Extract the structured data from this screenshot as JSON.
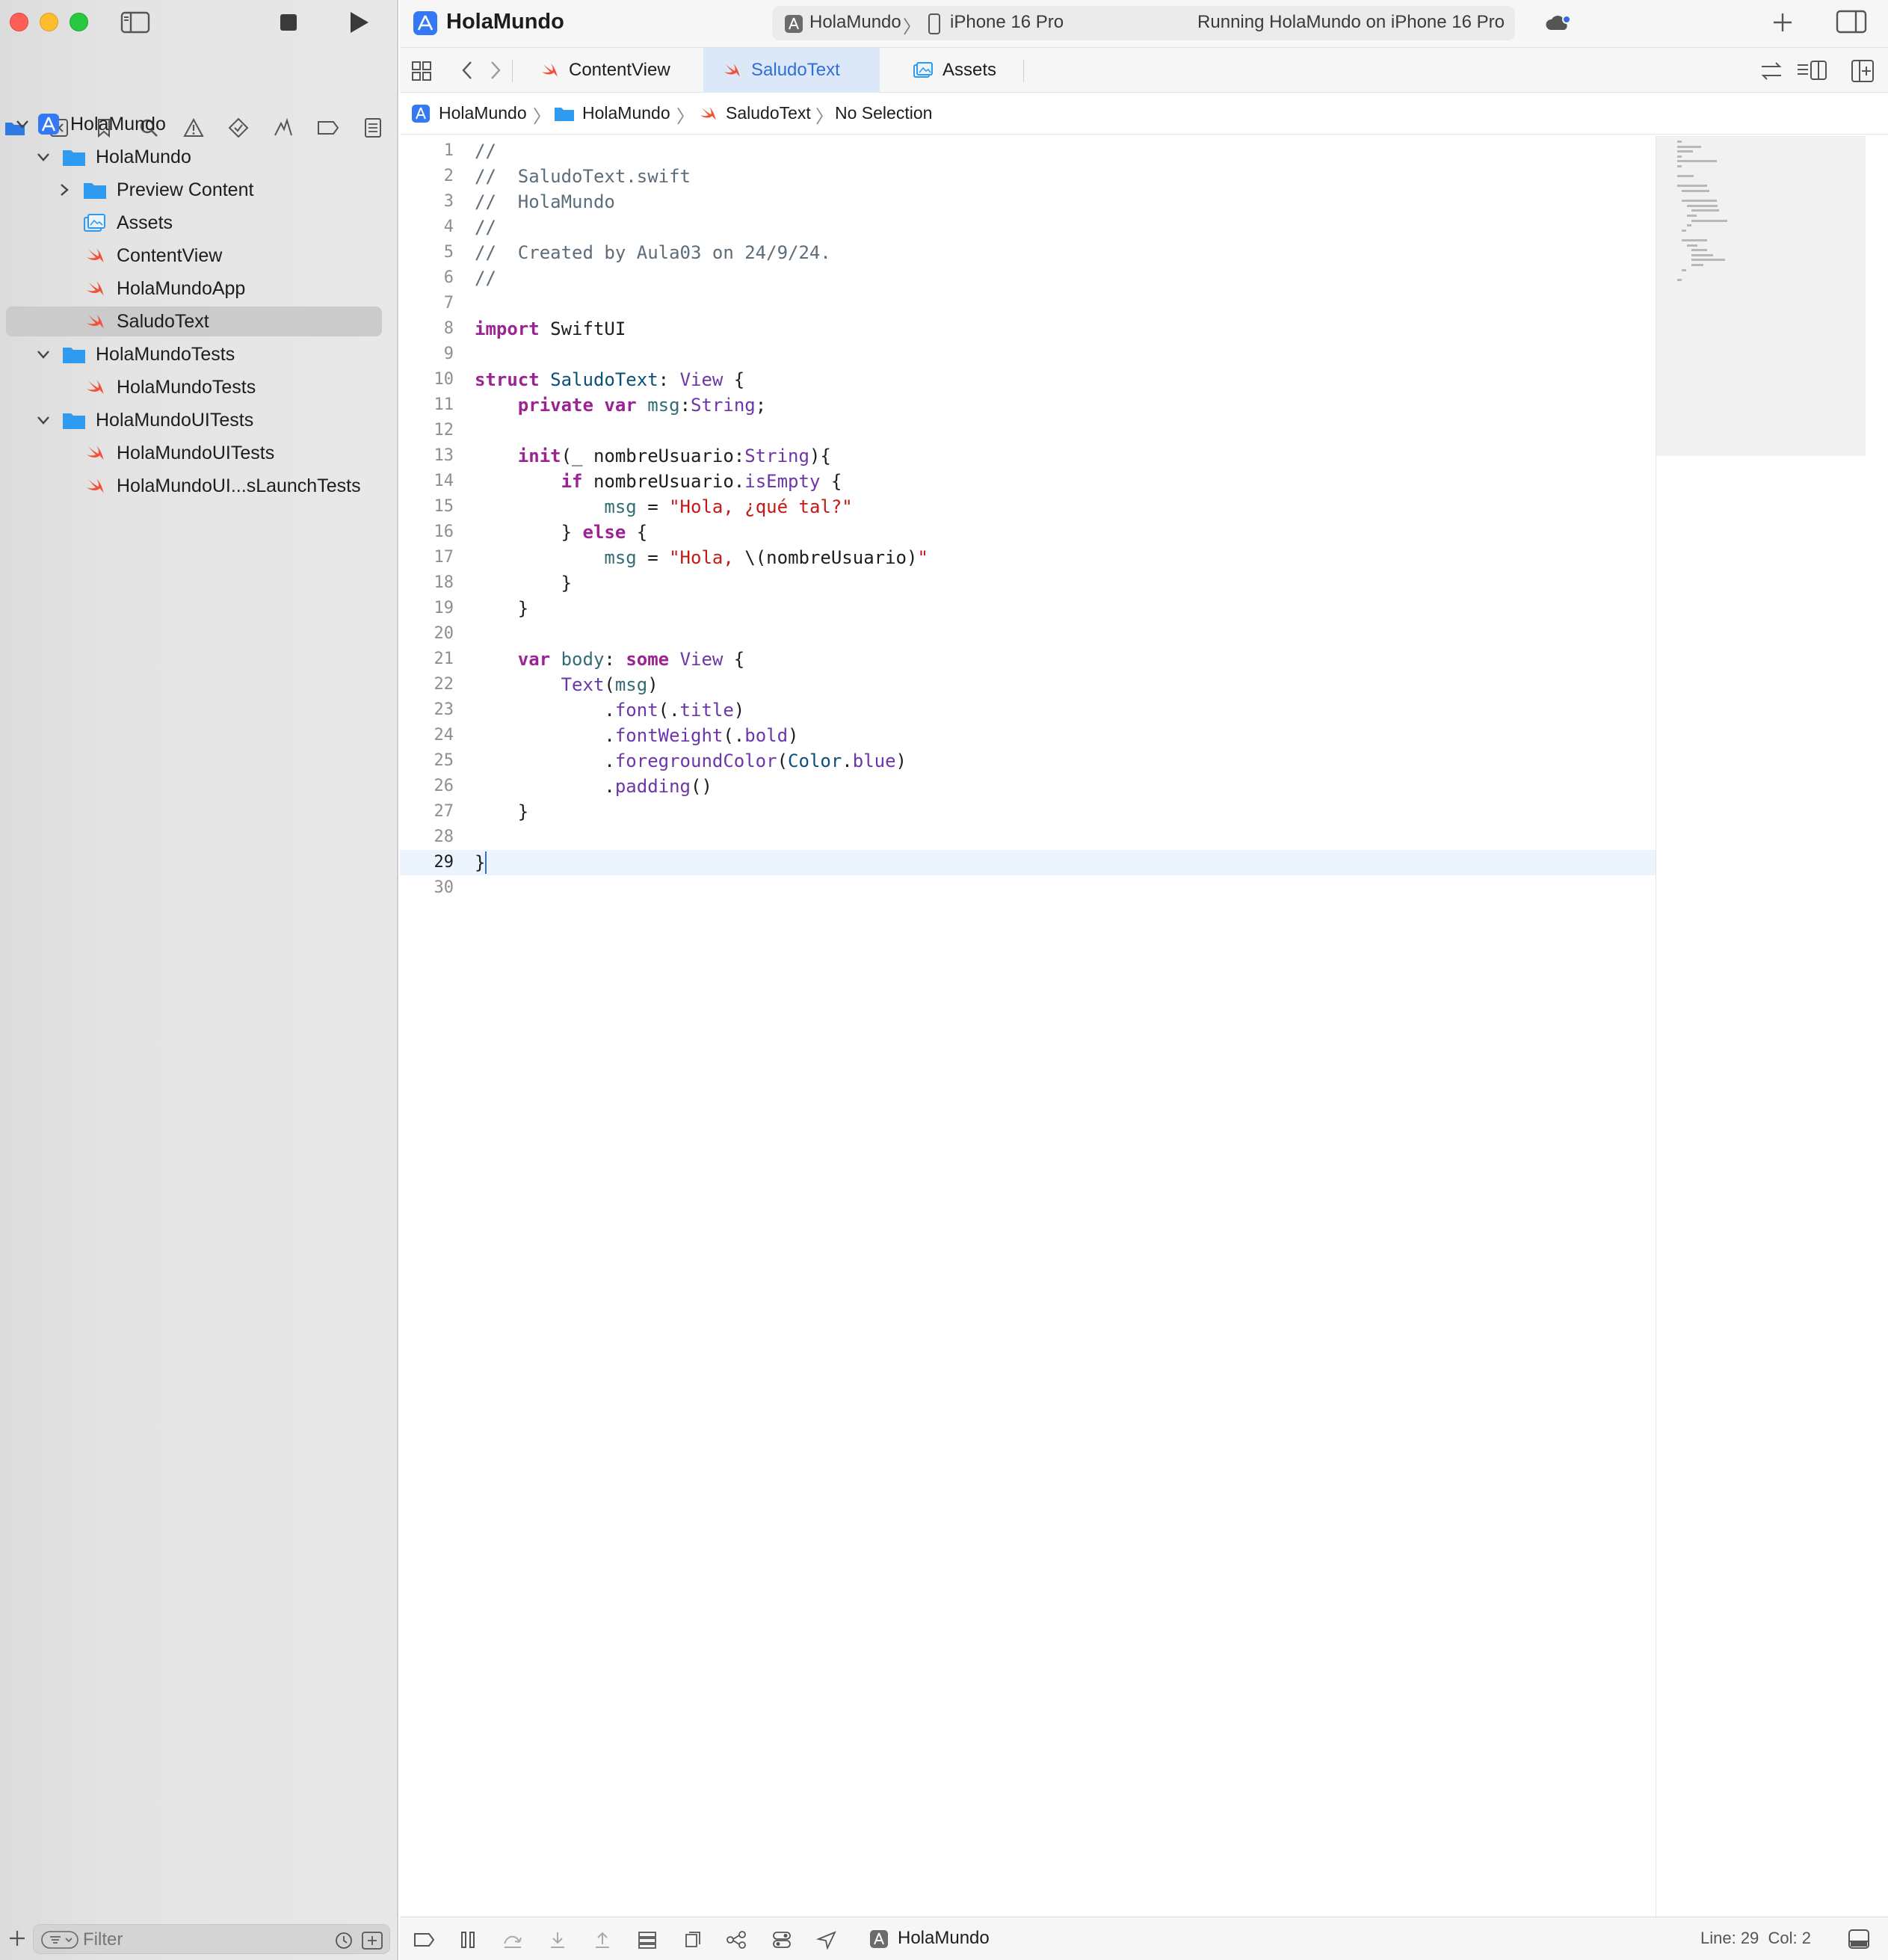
{
  "window": {
    "project_title": "HolaMundo"
  },
  "scheme": {
    "target": "HolaMundo",
    "device": "iPhone 16 Pro",
    "status": "Running HolaMundo on iPhone 16 Pro"
  },
  "navigator": {
    "tree": [
      {
        "label": "HolaMundo",
        "kind": "project",
        "level": 0,
        "disclosure": "open"
      },
      {
        "label": "HolaMundo",
        "kind": "folder",
        "level": 1,
        "disclosure": "open"
      },
      {
        "label": "Preview Content",
        "kind": "folder",
        "level": 2,
        "disclosure": "closed"
      },
      {
        "label": "Assets",
        "kind": "assets",
        "level": 2,
        "disclosure": "none"
      },
      {
        "label": "ContentView",
        "kind": "swift",
        "level": 2,
        "disclosure": "none"
      },
      {
        "label": "HolaMundoApp",
        "kind": "swift",
        "level": 2,
        "disclosure": "none"
      },
      {
        "label": "SaludoText",
        "kind": "swift",
        "level": 2,
        "disclosure": "none",
        "selected": true
      },
      {
        "label": "HolaMundoTests",
        "kind": "folder",
        "level": 1,
        "disclosure": "open"
      },
      {
        "label": "HolaMundoTests",
        "kind": "swift",
        "level": 2,
        "disclosure": "none"
      },
      {
        "label": "HolaMundoUITests",
        "kind": "folder",
        "level": 1,
        "disclosure": "open"
      },
      {
        "label": "HolaMundoUITests",
        "kind": "swift",
        "level": 2,
        "disclosure": "none"
      },
      {
        "label": "HolaMundoUI...sLaunchTests",
        "kind": "swift",
        "level": 2,
        "disclosure": "none"
      }
    ],
    "filter_placeholder": "Filter"
  },
  "tabs": [
    {
      "label": "ContentView",
      "icon": "swift-file-icon",
      "active": false
    },
    {
      "label": "SaludoText",
      "icon": "swift-file-icon",
      "active": true
    },
    {
      "label": "Assets",
      "icon": "asset-catalog-icon",
      "active": false
    }
  ],
  "breadcrumb": {
    "project": "HolaMundo",
    "folder": "HolaMundo",
    "file": "SaludoText",
    "selection": "No Selection"
  },
  "editor": {
    "current_line": 29,
    "lines": [
      [
        [
          "c-comment",
          "//"
        ]
      ],
      [
        [
          "c-comment",
          "//  SaludoText.swift"
        ]
      ],
      [
        [
          "c-comment",
          "//  HolaMundo"
        ]
      ],
      [
        [
          "c-comment",
          "//"
        ]
      ],
      [
        [
          "c-comment",
          "//  Created by Aula03 on 24/9/24."
        ]
      ],
      [
        [
          "c-comment",
          "//"
        ]
      ],
      [],
      [
        [
          "c-key",
          "import"
        ],
        [
          "c-plain",
          " SwiftUI"
        ]
      ],
      [],
      [
        [
          "c-key",
          "struct"
        ],
        [
          "c-plain",
          " "
        ],
        [
          "c-type",
          "SaludoText"
        ],
        [
          "c-plain",
          ": "
        ],
        [
          "c-prop",
          "View"
        ],
        [
          "c-plain",
          " {"
        ]
      ],
      [
        [
          "c-plain",
          "    "
        ],
        [
          "c-key",
          "private"
        ],
        [
          "c-plain",
          " "
        ],
        [
          "c-key",
          "var"
        ],
        [
          "c-plain",
          " "
        ],
        [
          "c-ident",
          "msg"
        ],
        [
          "c-plain",
          ":"
        ],
        [
          "c-prop",
          "String"
        ],
        [
          "c-plain",
          ";"
        ]
      ],
      [],
      [
        [
          "c-plain",
          "    "
        ],
        [
          "c-key",
          "init"
        ],
        [
          "c-plain",
          "(_ nombreUsuario:"
        ],
        [
          "c-prop",
          "String"
        ],
        [
          "c-plain",
          "){"
        ]
      ],
      [
        [
          "c-plain",
          "        "
        ],
        [
          "c-key",
          "if"
        ],
        [
          "c-plain",
          " nombreUsuario."
        ],
        [
          "c-prop",
          "isEmpty"
        ],
        [
          "c-plain",
          " {"
        ]
      ],
      [
        [
          "c-plain",
          "            "
        ],
        [
          "c-ident",
          "msg"
        ],
        [
          "c-plain",
          " = "
        ],
        [
          "c-str",
          "\"Hola, ¿qué tal?\""
        ]
      ],
      [
        [
          "c-plain",
          "        } "
        ],
        [
          "c-key",
          "else"
        ],
        [
          "c-plain",
          " {"
        ]
      ],
      [
        [
          "c-plain",
          "            "
        ],
        [
          "c-ident",
          "msg"
        ],
        [
          "c-plain",
          " = "
        ],
        [
          "c-str",
          "\"Hola, "
        ],
        [
          "c-plain",
          "\\(nombreUsuario)"
        ],
        [
          "c-str",
          "\""
        ]
      ],
      [
        [
          "c-plain",
          "        }"
        ]
      ],
      [
        [
          "c-plain",
          "    }"
        ]
      ],
      [],
      [
        [
          "c-plain",
          "    "
        ],
        [
          "c-key",
          "var"
        ],
        [
          "c-plain",
          " "
        ],
        [
          "c-ident",
          "body"
        ],
        [
          "c-plain",
          ": "
        ],
        [
          "c-key",
          "some"
        ],
        [
          "c-plain",
          " "
        ],
        [
          "c-prop",
          "View"
        ],
        [
          "c-plain",
          " {"
        ]
      ],
      [
        [
          "c-plain",
          "        "
        ],
        [
          "c-prop",
          "Text"
        ],
        [
          "c-plain",
          "("
        ],
        [
          "c-ident",
          "msg"
        ],
        [
          "c-plain",
          ")"
        ]
      ],
      [
        [
          "c-plain",
          "            ."
        ],
        [
          "c-prop",
          "font"
        ],
        [
          "c-plain",
          "(."
        ],
        [
          "c-prop",
          "title"
        ],
        [
          "c-plain",
          ")"
        ]
      ],
      [
        [
          "c-plain",
          "            ."
        ],
        [
          "c-prop",
          "fontWeight"
        ],
        [
          "c-plain",
          "(."
        ],
        [
          "c-prop",
          "bold"
        ],
        [
          "c-plain",
          ")"
        ]
      ],
      [
        [
          "c-plain",
          "            ."
        ],
        [
          "c-prop",
          "foregroundColor"
        ],
        [
          "c-plain",
          "("
        ],
        [
          "c-type",
          "Color"
        ],
        [
          "c-plain",
          "."
        ],
        [
          "c-prop",
          "blue"
        ],
        [
          "c-plain",
          ")"
        ]
      ],
      [
        [
          "c-plain",
          "            ."
        ],
        [
          "c-prop",
          "padding"
        ],
        [
          "c-plain",
          "()"
        ]
      ],
      [
        [
          "c-plain",
          "    }"
        ]
      ],
      [],
      [
        [
          "c-plain",
          "}"
        ]
      ],
      []
    ]
  },
  "debugbar": {
    "app": "HolaMundo",
    "cursor": "Line: 29  Col: 2"
  },
  "colors": {
    "accent": "#2f6fd9",
    "swift_orange": "#f05138",
    "folder_blue": "#2f9bf0",
    "keyword": "#9b2393",
    "string": "#c41a16"
  }
}
